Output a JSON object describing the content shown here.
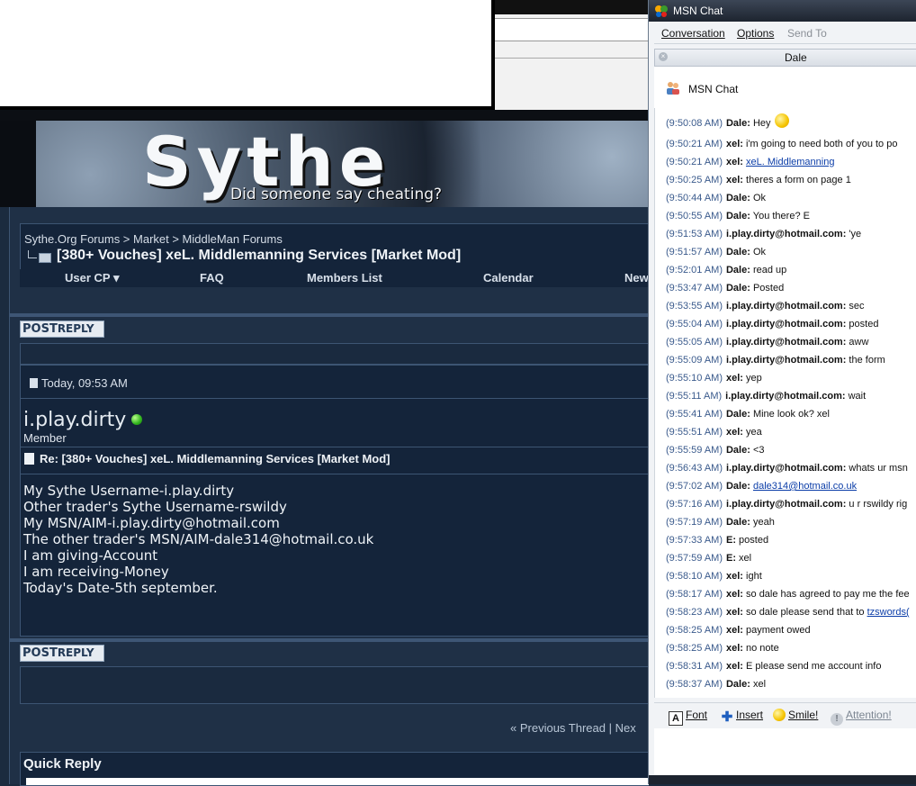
{
  "forum": {
    "logo_text": "Sythe",
    "tagline": "Did someone say cheating?",
    "breadcrumb": "Sythe.Org Forums > Market > MiddleMan Forums",
    "thread_title": "[380+ Vouches] xeL. Middlemanning Services [Market Mod]",
    "nav": [
      "User CP ▾",
      "FAQ",
      "Members List",
      "Calendar",
      "New"
    ],
    "post_reply_label": "POST",
    "post_reply_label2": "REPLY",
    "post": {
      "date": "Today, 09:53 AM",
      "username": "i.play.dirty",
      "usertitle": "Member",
      "title": "Re: [380+ Vouches] xeL. Middlemanning Services [Market Mod]",
      "body": [
        "My Sythe Username-i.play.dirty",
        "Other trader's Sythe Username-rswildy",
        "My MSN/AIM-i.play.dirty@hotmail.com",
        "The other trader's MSN/AIM-dale314@hotmail.co.uk",
        "I am giving-Account",
        "I am receiving-Money",
        "Today's Date-5th september."
      ]
    },
    "prev_thread": "« Previous Thread | Nex",
    "quick_reply": "Quick Reply"
  },
  "msn": {
    "window_title": "MSN Chat",
    "menu": [
      "Conversation",
      "Options",
      "Send To"
    ],
    "tab_name": "Dale",
    "header": "MSN Chat",
    "messages": [
      {
        "ts": "(9:50:08 AM)",
        "who": "Dale:",
        "text": "Hey",
        "link": ""
      },
      {
        "ts": "(9:50:21 AM)",
        "who": "xel:",
        "text": "i'm going to need both of you to po",
        "link": ""
      },
      {
        "ts": "(9:50:21 AM)",
        "who": "xel:",
        "text": "",
        "link": "xeL. Middlemanning"
      },
      {
        "ts": "(9:50:25 AM)",
        "who": "xel:",
        "text": "theres a form on page 1",
        "link": ""
      },
      {
        "ts": "(9:50:44 AM)",
        "who": "Dale:",
        "text": "Ok",
        "link": ""
      },
      {
        "ts": "(9:50:55 AM)",
        "who": "Dale:",
        "text": "You there? E",
        "link": ""
      },
      {
        "ts": "(9:51:53 AM)",
        "who": "i.play.dirty@hotmail.com:",
        "text": "'ye",
        "link": ""
      },
      {
        "ts": "(9:51:57 AM)",
        "who": "Dale:",
        "text": "Ok",
        "link": ""
      },
      {
        "ts": "(9:52:01 AM)",
        "who": "Dale:",
        "text": "read up",
        "link": ""
      },
      {
        "ts": "(9:53:47 AM)",
        "who": "Dale:",
        "text": "Posted",
        "link": ""
      },
      {
        "ts": "(9:53:55 AM)",
        "who": "i.play.dirty@hotmail.com:",
        "text": "sec",
        "link": ""
      },
      {
        "ts": "(9:55:04 AM)",
        "who": "i.play.dirty@hotmail.com:",
        "text": "posted",
        "link": ""
      },
      {
        "ts": "(9:55:05 AM)",
        "who": "i.play.dirty@hotmail.com:",
        "text": "aww",
        "link": ""
      },
      {
        "ts": "(9:55:09 AM)",
        "who": "i.play.dirty@hotmail.com:",
        "text": "the form",
        "link": ""
      },
      {
        "ts": "(9:55:10 AM)",
        "who": "xel:",
        "text": "yep",
        "link": ""
      },
      {
        "ts": "(9:55:11 AM)",
        "who": "i.play.dirty@hotmail.com:",
        "text": "wait",
        "link": ""
      },
      {
        "ts": "(9:55:41 AM)",
        "who": "Dale:",
        "text": "Mine look ok? xel",
        "link": ""
      },
      {
        "ts": "(9:55:51 AM)",
        "who": "xel:",
        "text": "yea",
        "link": ""
      },
      {
        "ts": "(9:55:59 AM)",
        "who": "Dale:",
        "text": "<3",
        "link": ""
      },
      {
        "ts": "(9:56:43 AM)",
        "who": "i.play.dirty@hotmail.com:",
        "text": "whats ur msn",
        "link": ""
      },
      {
        "ts": "(9:57:02 AM)",
        "who": "Dale:",
        "text": "",
        "link": "dale314@hotmail.co.uk"
      },
      {
        "ts": "(9:57:16 AM)",
        "who": "i.play.dirty@hotmail.com:",
        "text": "u r rswildy rig",
        "link": ""
      },
      {
        "ts": "(9:57:19 AM)",
        "who": "Dale:",
        "text": "yeah",
        "link": ""
      },
      {
        "ts": "(9:57:33 AM)",
        "who": "E:",
        "text": "posted",
        "link": ""
      },
      {
        "ts": "(9:57:59 AM)",
        "who": "E:",
        "text": "xel",
        "link": ""
      },
      {
        "ts": "(9:58:10 AM)",
        "who": "xel:",
        "text": "ight",
        "link": ""
      },
      {
        "ts": "(9:58:17 AM)",
        "who": "xel:",
        "text": "so dale has agreed to pay me the fee",
        "link": ""
      },
      {
        "ts": "(9:58:23 AM)",
        "who": "xel:",
        "text": "so dale please send that to ",
        "link": "tzswords("
      },
      {
        "ts": "(9:58:25 AM)",
        "who": "xel:",
        "text": "payment owed",
        "link": ""
      },
      {
        "ts": "(9:58:25 AM)",
        "who": "xel:",
        "text": "no note",
        "link": ""
      },
      {
        "ts": "(9:58:31 AM)",
        "who": "xel:",
        "text": "E please send me account info",
        "link": ""
      },
      {
        "ts": "(9:58:37 AM)",
        "who": "Dale:",
        "text": "xel",
        "link": ""
      }
    ],
    "toolbar": {
      "font": "Font",
      "insert": "Insert",
      "smile": "Smile!",
      "attention": "Attention!"
    }
  }
}
